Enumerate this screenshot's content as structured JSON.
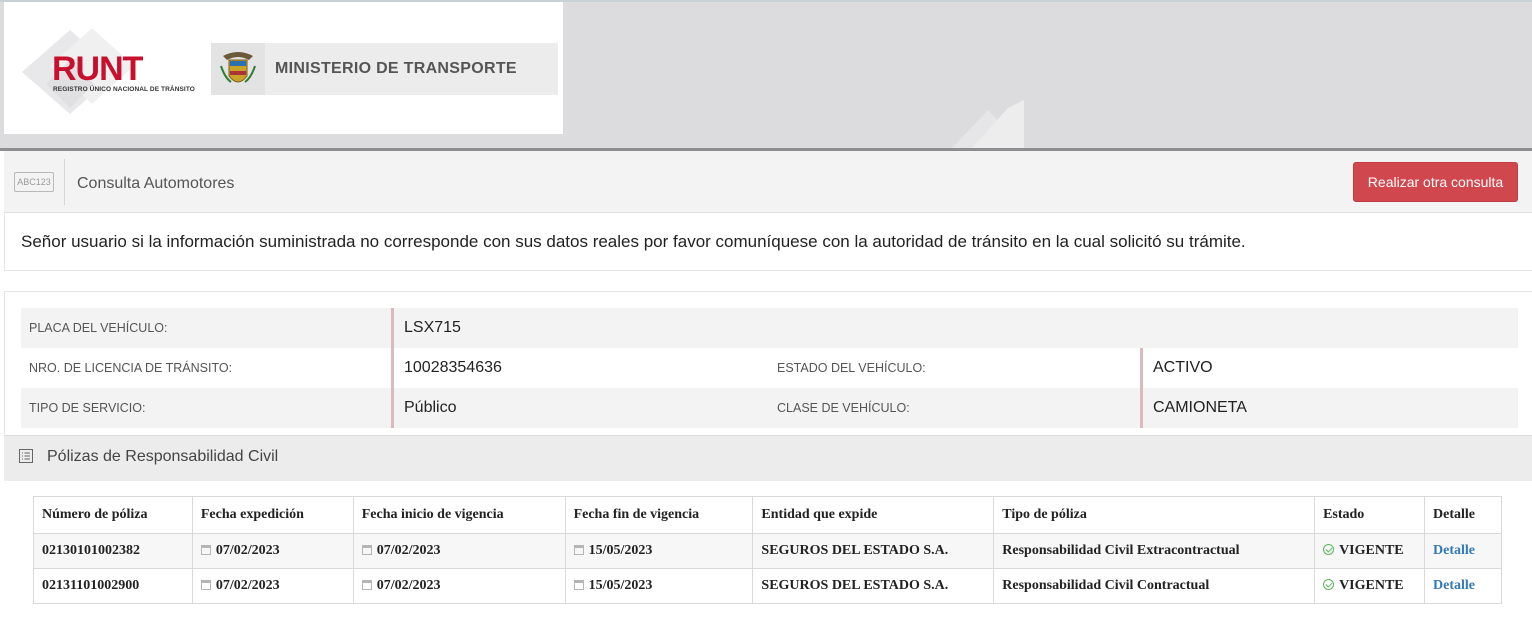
{
  "header": {
    "runt_logo_text": "RUNT",
    "runt_logo_subtitle": "REGISTRO ÚNICO NACIONAL DE TRÁNSITO",
    "ministry_name": "MINISTERIO DE TRANSPORTE"
  },
  "query_bar": {
    "plate_icon_text": "ABC123",
    "title": "Consulta Automotores",
    "new_query_button": "Realizar otra consulta"
  },
  "notice": {
    "text": "Señor usuario si la información suministrada no corresponde con sus datos reales por favor comuníquese con la autoridad de tránsito en la cual solicitó su trámite."
  },
  "vehicle": {
    "plate_label": "PLACA DEL VEHÍCULO:",
    "plate_value": "LSX715",
    "license_label": "NRO. DE LICENCIA DE TRÁNSITO:",
    "license_value": "10028354636",
    "status_label": "ESTADO DEL VEHÍCULO:",
    "status_value": "ACTIVO",
    "service_label": "TIPO DE SERVICIO:",
    "service_value": "Público",
    "class_label": "CLASE DE VEHÍCULO:",
    "class_value": "CAMIONETA"
  },
  "policies": {
    "section_title": "Pólizas de Responsabilidad Civil",
    "columns": [
      "Número de póliza",
      "Fecha expedición",
      "Fecha inicio de vigencia",
      "Fecha fin de vigencia",
      "Entidad que expide",
      "Tipo de póliza",
      "Estado",
      "Detalle"
    ],
    "rows": [
      {
        "number": "02130101002382",
        "issue_date": "07/02/2023",
        "start_date": "07/02/2023",
        "end_date": "15/05/2023",
        "entity": "SEGUROS DEL ESTADO S.A.",
        "type": "Responsabilidad Civil Extracontractual",
        "status": "VIGENTE",
        "detail": "Detalle"
      },
      {
        "number": "02131101002900",
        "issue_date": "07/02/2023",
        "start_date": "07/02/2023",
        "end_date": "15/05/2023",
        "entity": "SEGUROS DEL ESTADO S.A.",
        "type": "Responsabilidad Civil Contractual",
        "status": "VIGENTE",
        "detail": "Detalle"
      }
    ]
  },
  "colors": {
    "runt_red": "#c8102e",
    "button_red": "#d0474e",
    "link_blue": "#337ab7",
    "status_green": "#5cb85c",
    "value_border": "#dcb9bd"
  }
}
